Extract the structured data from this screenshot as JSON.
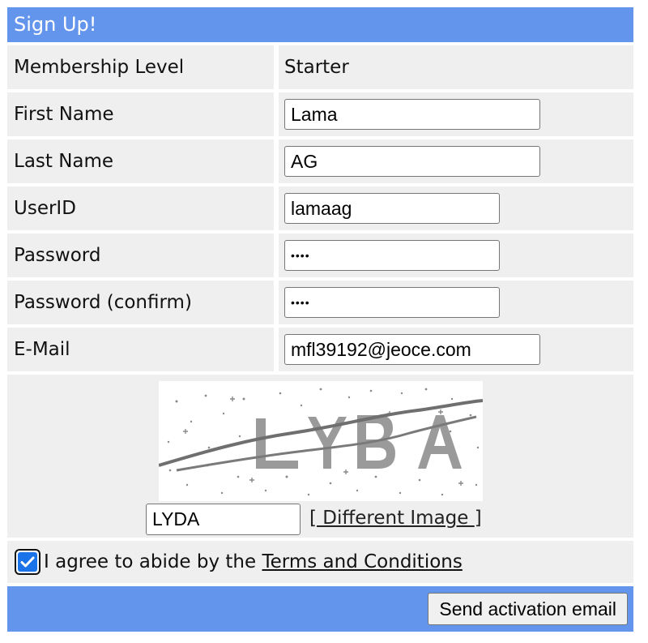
{
  "header": {
    "title": "Sign Up!"
  },
  "fields": {
    "membership": {
      "label": "Membership Level",
      "value": "Starter"
    },
    "first_name": {
      "label": "First Name",
      "value": "Lama"
    },
    "last_name": {
      "label": "Last Name",
      "value": "AG"
    },
    "userid": {
      "label": "UserID",
      "value": "lamaag"
    },
    "password": {
      "label": "Password",
      "value": "••••"
    },
    "password_confirm": {
      "label": "Password (confirm)",
      "value": "••••"
    },
    "email": {
      "label": "E-Mail",
      "value": "mfl39192@jeoce.com"
    }
  },
  "captcha": {
    "image_text": "LYBA",
    "input_value": "LYDA",
    "different_image_open": "[",
    "different_image_label": " Different Image ",
    "different_image_close": "]"
  },
  "agree": {
    "checked": true,
    "text": "I agree to abide by the ",
    "link": "Terms and Conditions"
  },
  "footer": {
    "send_label": "Send activation email"
  },
  "colors": {
    "header_bg": "#6495ed",
    "row_bg": "#efefef",
    "checkbox": "#1a73e8"
  }
}
